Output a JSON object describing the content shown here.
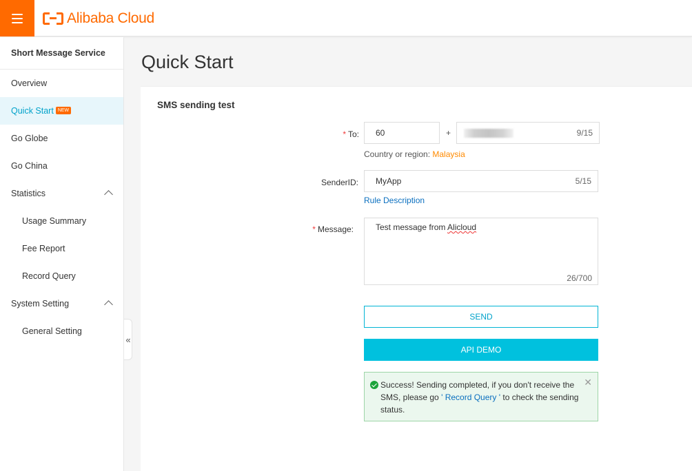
{
  "topbar": {
    "menu_icon": "hamburger-icon",
    "brand": "Alibaba Cloud",
    "brand_color": "#ff6a00"
  },
  "sidebar": {
    "title": "Short Message Service",
    "items": [
      {
        "label": "Overview"
      },
      {
        "label": "Quick Start",
        "badge": "NEW",
        "active": true
      },
      {
        "label": "Go Globe"
      },
      {
        "label": "Go China"
      },
      {
        "label": "Statistics",
        "expanded": true
      },
      {
        "label": "Usage Summary"
      },
      {
        "label": "Fee Report"
      },
      {
        "label": "Record Query"
      },
      {
        "label": "System Setting",
        "expanded": true
      },
      {
        "label": "General Setting"
      }
    ],
    "collapse_icon": "double-chevron-left-icon"
  },
  "page": {
    "title": "Quick Start"
  },
  "form": {
    "section_title": "SMS sending test",
    "to": {
      "label": "To:",
      "country_code": "60",
      "separator": "+",
      "number_count": "9/15",
      "hint_prefix": "Country or region: ",
      "hint_country": "Malaysia"
    },
    "sender": {
      "label": "SenderID:",
      "value": "MyApp",
      "count": "5/15",
      "rule_link": "Rule Description"
    },
    "message": {
      "label": "Message:",
      "value_prefix": "Test message from ",
      "value_word": "Alicloud",
      "count": "26/700"
    },
    "send_button": "SEND",
    "api_button": "API DEMO"
  },
  "alert": {
    "icon": "check-circle-icon",
    "text_1": "Success! Sending completed, if you don't receive the SMS, please go",
    "link": "' Record Query '",
    "text_2": "to check the sending status.",
    "close_icon": "close-icon"
  },
  "colors": {
    "accent": "#00c1de",
    "active_text": "#00a2ca",
    "success_bg": "#ebf7ee",
    "required": "#f03c3c"
  }
}
